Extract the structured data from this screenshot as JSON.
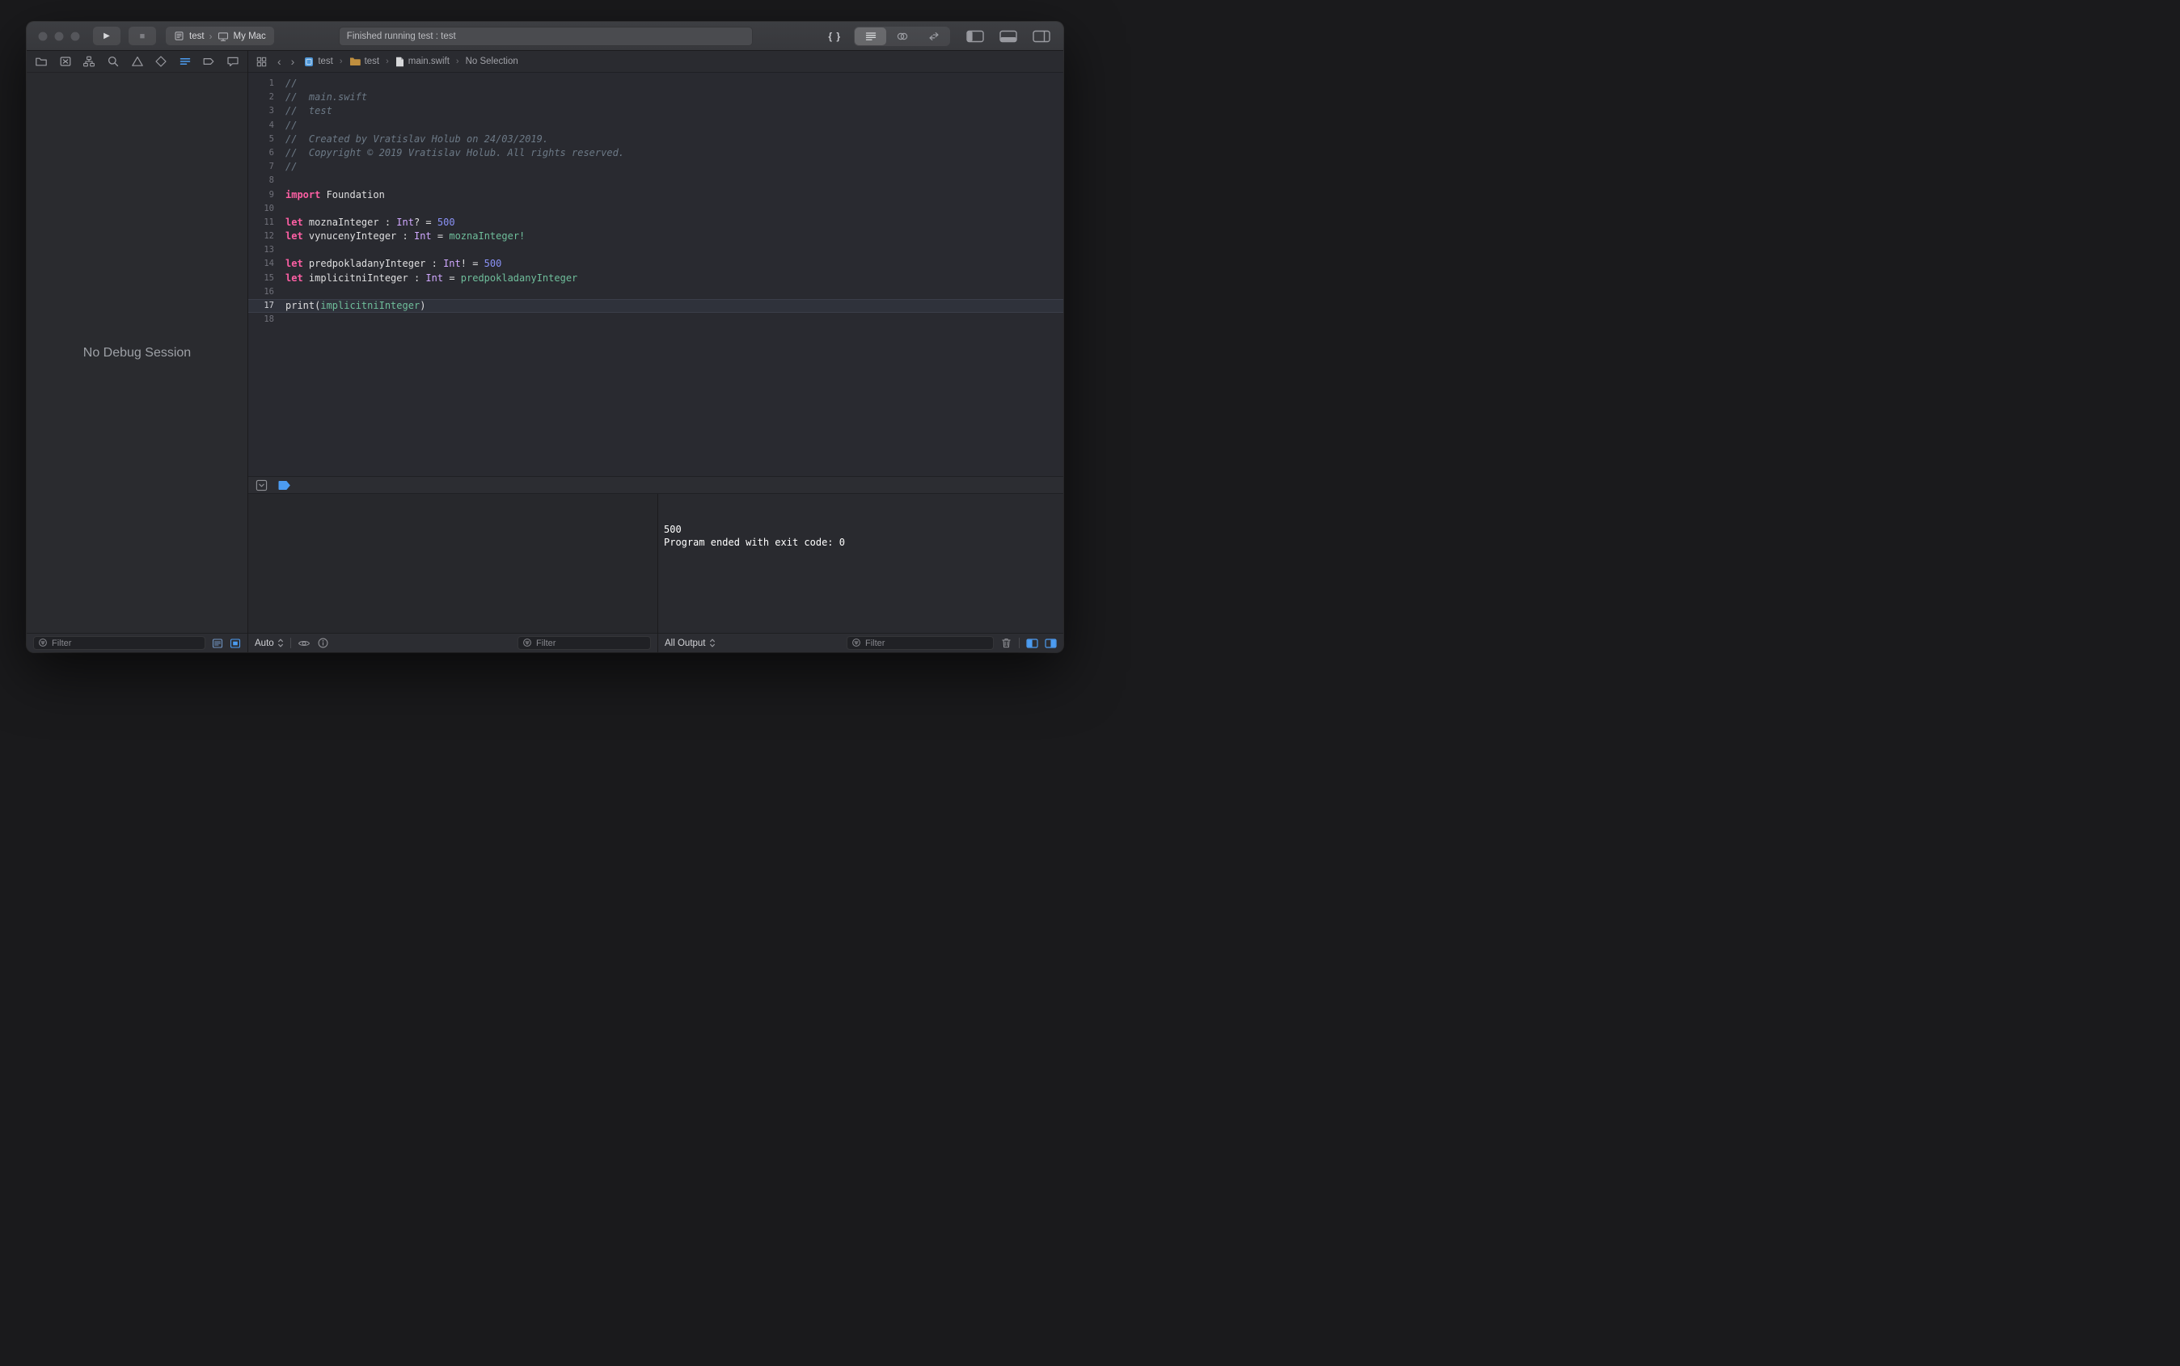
{
  "titlebar": {
    "run_icon": "▶",
    "stop_icon": "■",
    "braces_label": "{ }",
    "scheme": {
      "target": "test",
      "separator": "›",
      "destination": "My Mac"
    },
    "activity_status": "Finished running test : test"
  },
  "navigator": {
    "active_index": 6,
    "empty_message": "No Debug Session",
    "filter_placeholder": "Filter"
  },
  "jumpbar": {
    "back": "‹",
    "forward": "›",
    "separator": "›",
    "crumbs": [
      {
        "label": "test"
      },
      {
        "label": "test"
      },
      {
        "label": "main.swift"
      },
      {
        "label": "No Selection"
      }
    ]
  },
  "editor": {
    "code": {
      "current_line": 17,
      "lines": [
        {
          "n": 1,
          "tokens": [
            [
              "c",
              "//"
            ]
          ]
        },
        {
          "n": 2,
          "tokens": [
            [
              "c",
              "//  main.swift"
            ]
          ]
        },
        {
          "n": 3,
          "tokens": [
            [
              "c",
              "//  test"
            ]
          ]
        },
        {
          "n": 4,
          "tokens": [
            [
              "c",
              "//"
            ]
          ]
        },
        {
          "n": 5,
          "tokens": [
            [
              "c",
              "//  Created by Vratislav Holub on 24/03/2019."
            ]
          ]
        },
        {
          "n": 6,
          "tokens": [
            [
              "c",
              "//  Copyright © 2019 Vratislav Holub. All rights reserved."
            ]
          ]
        },
        {
          "n": 7,
          "tokens": [
            [
              "c",
              "//"
            ]
          ]
        },
        {
          "n": 8,
          "tokens": []
        },
        {
          "n": 9,
          "tokens": [
            [
              "k",
              "import"
            ],
            [
              "p",
              " Foundation"
            ]
          ]
        },
        {
          "n": 10,
          "tokens": []
        },
        {
          "n": 11,
          "tokens": [
            [
              "k",
              "let"
            ],
            [
              "p",
              " moznaInteger : "
            ],
            [
              "t",
              "Int"
            ],
            [
              "p",
              "? = "
            ],
            [
              "n",
              "500"
            ]
          ]
        },
        {
          "n": 12,
          "tokens": [
            [
              "k",
              "let"
            ],
            [
              "p",
              " vynucenyInteger : "
            ],
            [
              "t",
              "Int"
            ],
            [
              "p",
              " = "
            ],
            [
              "g",
              "moznaInteger!"
            ]
          ]
        },
        {
          "n": 13,
          "tokens": []
        },
        {
          "n": 14,
          "tokens": [
            [
              "k",
              "let"
            ],
            [
              "p",
              " predpokladanyInteger : "
            ],
            [
              "t",
              "Int"
            ],
            [
              "p",
              "! = "
            ],
            [
              "n",
              "500"
            ]
          ]
        },
        {
          "n": 15,
          "tokens": [
            [
              "k",
              "let"
            ],
            [
              "p",
              " implicitniInteger : "
            ],
            [
              "t",
              "Int"
            ],
            [
              "p",
              " = "
            ],
            [
              "g",
              "predpokladanyInteger"
            ]
          ]
        },
        {
          "n": 16,
          "tokens": []
        },
        {
          "n": 17,
          "tokens": [
            [
              "p",
              "print("
            ],
            [
              "g",
              "implicitniInteger"
            ],
            [
              "p",
              ")"
            ]
          ]
        },
        {
          "n": 18,
          "tokens": []
        }
      ]
    }
  },
  "debug": {
    "variables": {
      "scope_label": "Auto",
      "filter_placeholder": "Filter"
    },
    "console": {
      "scope_label": "All Output",
      "filter_placeholder": "Filter",
      "output_lines": [
        "500",
        "Program ended with exit code: 0"
      ]
    }
  },
  "icons": {
    "run": "▶",
    "stop": "■",
    "back": "‹",
    "forward": "›",
    "breadcrumb-separator": "›",
    "filter": "circle-with-lines",
    "trash": "trash-can",
    "quick-look": "eye",
    "print-description": "circled-i",
    "navigator_bar": [
      "folder",
      "x-square",
      "org-chart",
      "magnifier",
      "warning-triangle",
      "diamond",
      "bars",
      "tag",
      "speech-bubble"
    ]
  },
  "colors": {
    "accent_blue": "#4C9CF1",
    "keyword_pink": "#FC5FA3",
    "comment_gray": "#6C7986",
    "type_purple": "#D0A8FF",
    "number_blue": "#8B93F8",
    "project_green": "#6FBE9B",
    "plain_text": "#DFDFE0"
  }
}
